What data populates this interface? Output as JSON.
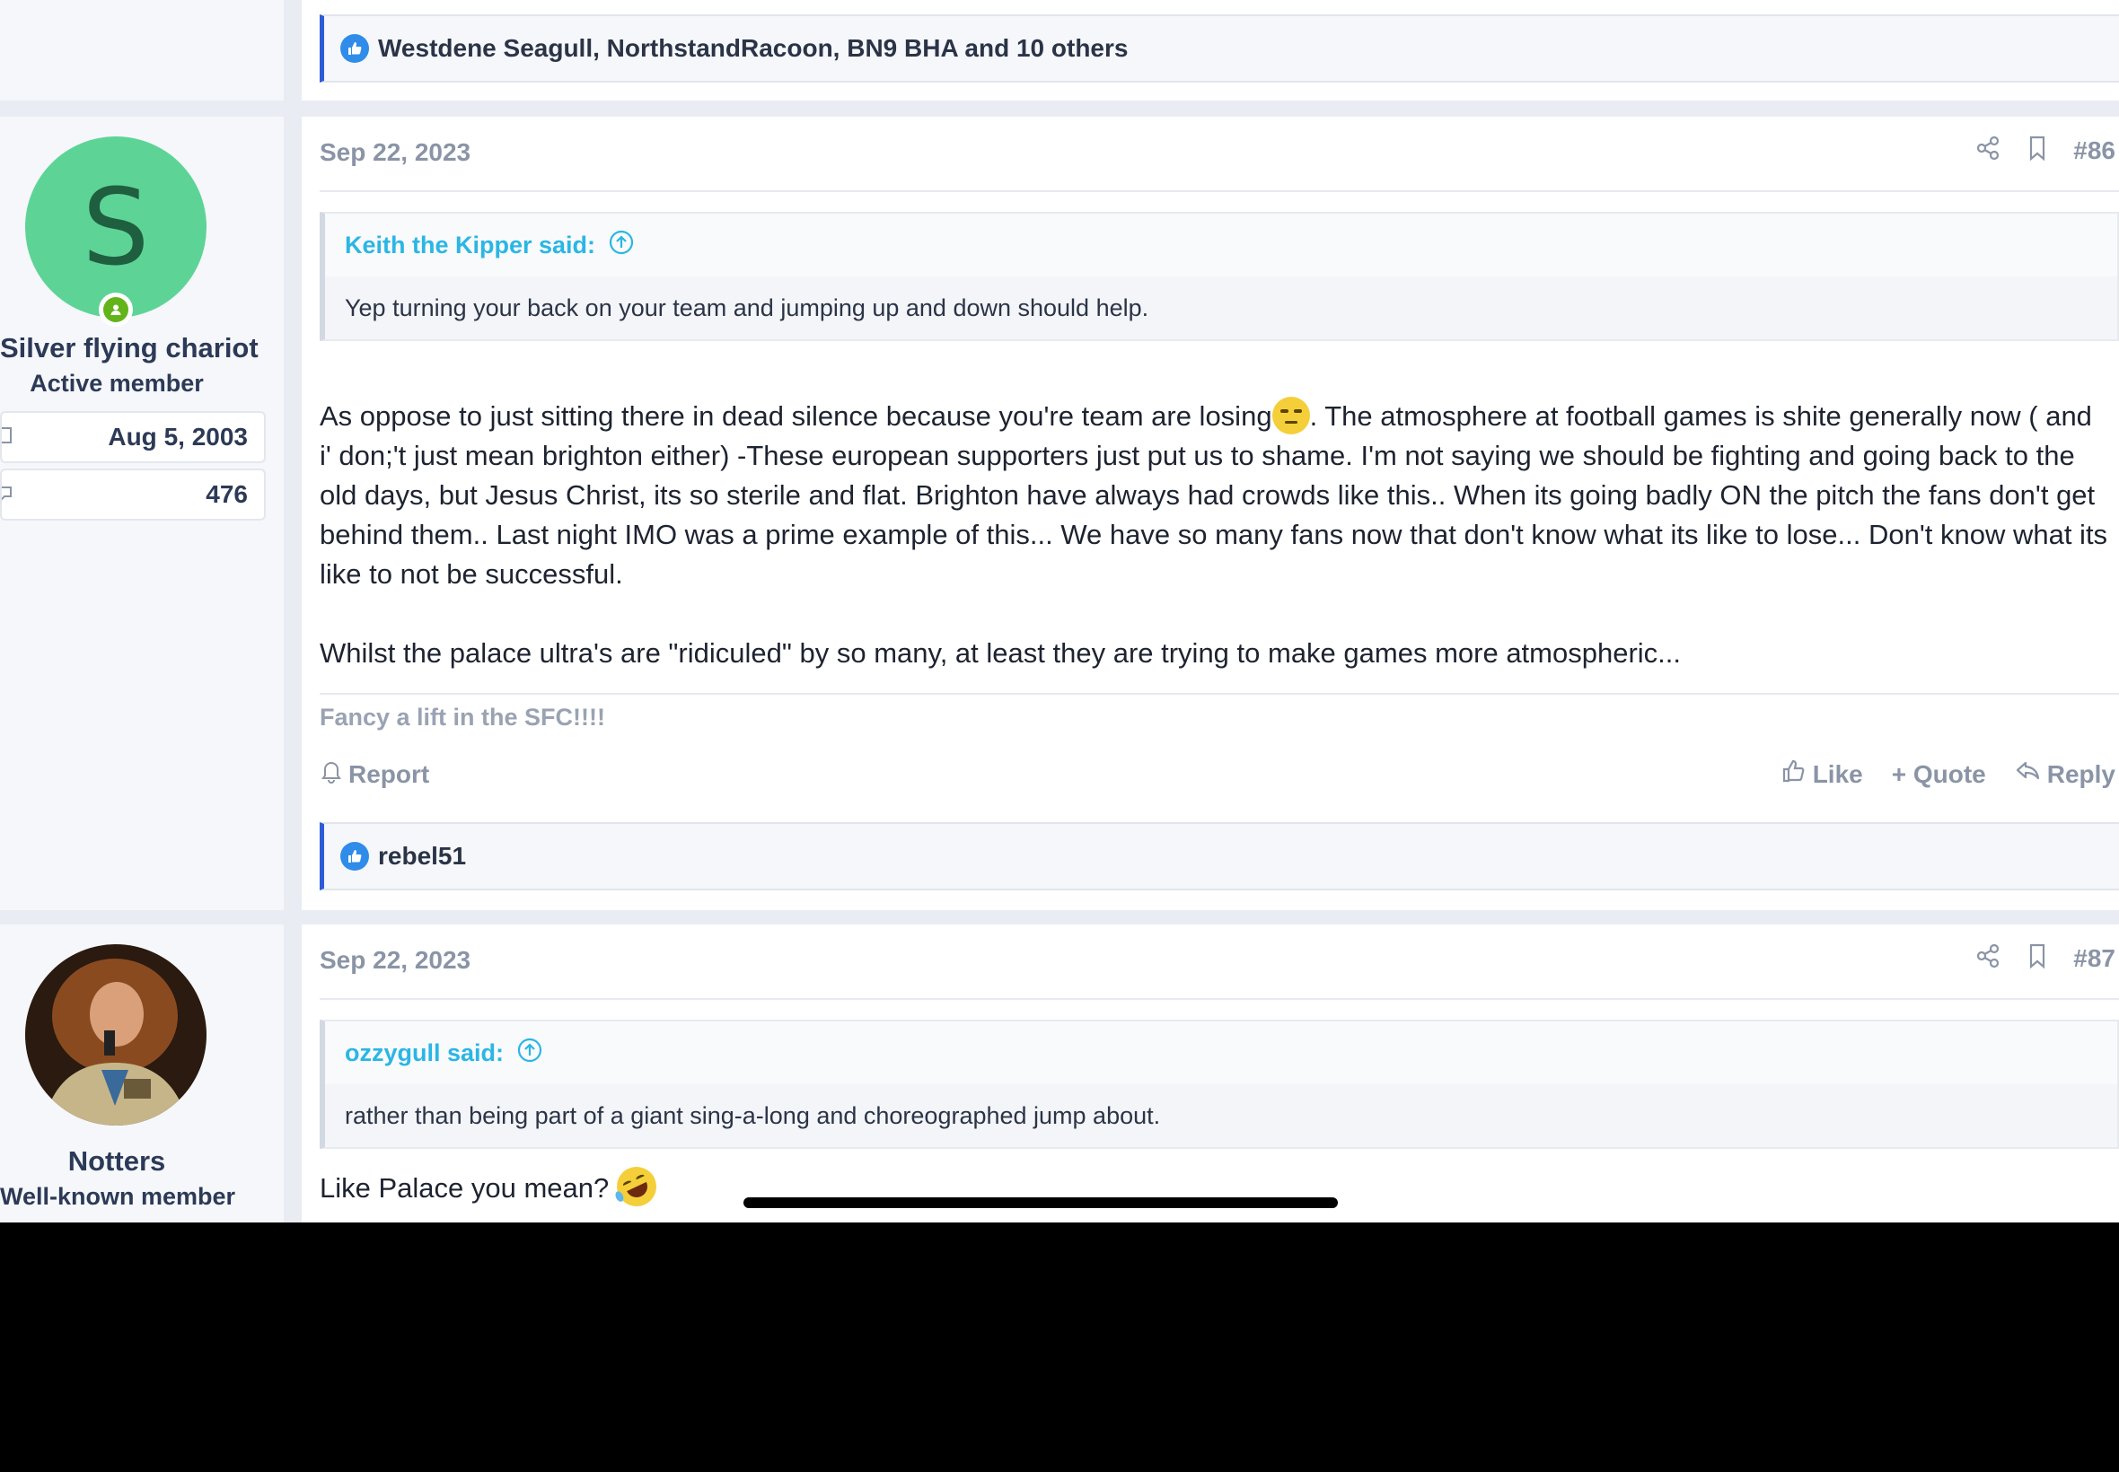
{
  "reactions_top": {
    "text": "Westdene Seagull, NorthstandRacoon, BN9 BHA and 10 others"
  },
  "post86": {
    "date": "Sep 22, 2023",
    "number": "#86",
    "user": {
      "avatar_letter": "S",
      "name": "Silver flying chariot",
      "title": "Active member",
      "joined": "Aug 5, 2003",
      "messages": "476"
    },
    "quote": {
      "author": "Keith the Kipper said:",
      "text": "Yep turning your back on your team and jumping up and down should help."
    },
    "message_before_emoji": "As oppose to just sitting there in dead silence because you're team are losing",
    "message_after_emoji": ". The atmosphere at football games is shite generally now ( and i' don;'t just mean brighton either) -These european supporters just put us to shame. I'm not saying we should be fighting and going back to the old days, but Jesus Christ, its so sterile and flat. Brighton have always had crowds like this.. When its going badly ON the pitch the fans don't get behind them.. Last night IMO was a prime example of this... We have so many fans now that don't know what its like to lose... Don't know what its like to not be successful.",
    "message_para2": "Whilst the palace ultra's are \"ridiculed\" by so many, at least they are trying to make games more atmospheric...",
    "signature": "Fancy a lift in the SFC!!!!",
    "actions": {
      "report": "Report",
      "like": "Like",
      "quote": "+ Quote",
      "reply": "Reply"
    },
    "reactions": "rebel51"
  },
  "post87": {
    "date": "Sep 22, 2023",
    "number": "#87",
    "user": {
      "name": "Notters",
      "title": "Well-known member"
    },
    "quote": {
      "author": "ozzygull said:",
      "text": "rather than being part of a giant sing-a-long and choreographed jump about."
    },
    "message": "Like Palace you mean?"
  },
  "colors": {
    "avatar_bg": "#5dd496",
    "quote_author": "#2bb6e4",
    "reaction_border": "#2d5bd8",
    "online": "#63b41a"
  },
  "icons": [
    "like-icon",
    "share-icon",
    "bookmark-icon",
    "quote-arrow-icon",
    "calendar-icon",
    "messages-icon",
    "bell-icon",
    "thumbs-up-icon",
    "plus-icon",
    "reply-icon",
    "online-icon",
    "unamused-emoji-icon",
    "rofl-emoji-icon"
  ]
}
